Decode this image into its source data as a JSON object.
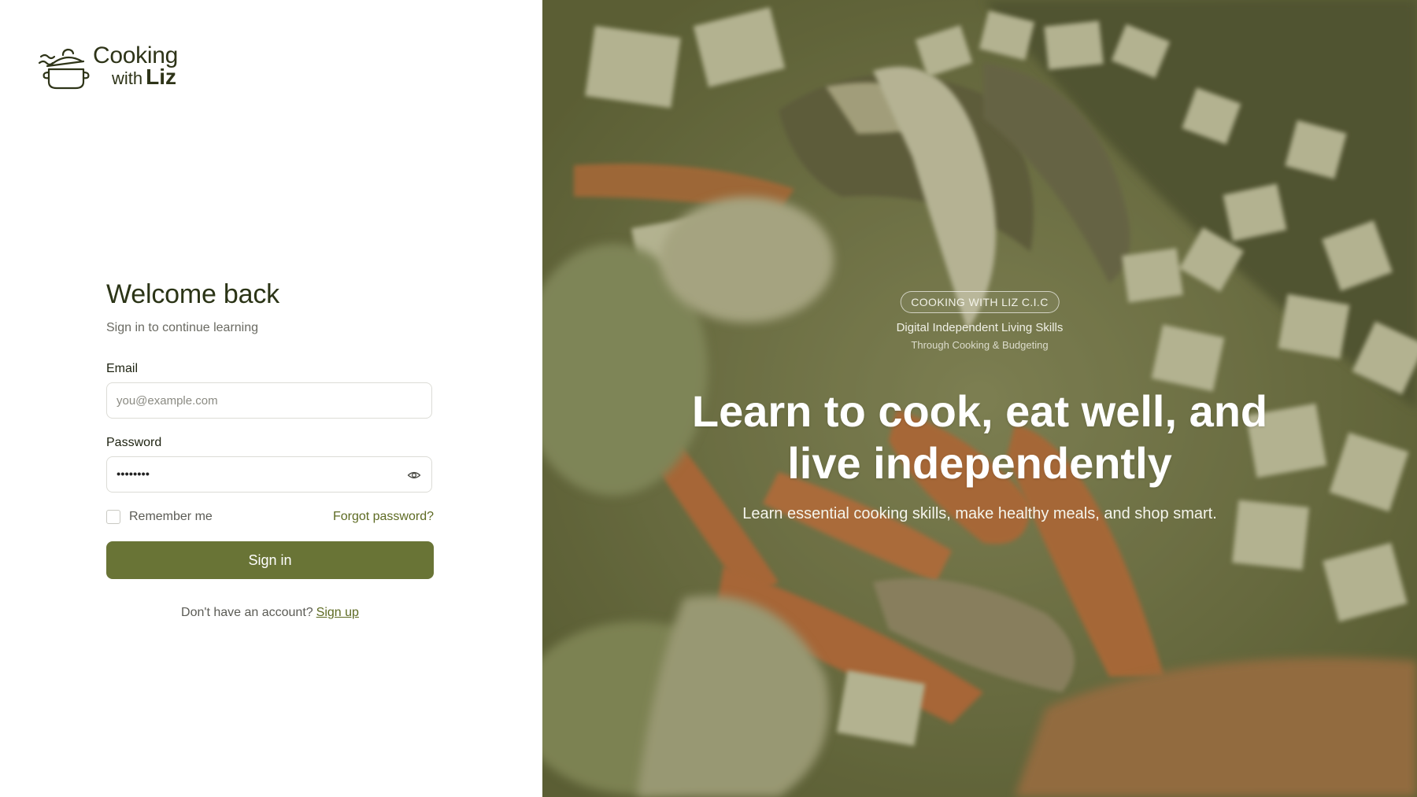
{
  "brand": {
    "line1": "Cooking",
    "line2_prefix": "with",
    "line2_name": "Liz"
  },
  "login": {
    "title": "Welcome back",
    "subtitle": "Sign in to continue learning",
    "email_label": "Email",
    "email_placeholder": "you@example.com",
    "email_value": "",
    "password_label": "Password",
    "password_masked": "••••••••",
    "remember_label": "Remember me",
    "remember_checked": false,
    "forgot_label": "Forgot password?",
    "signin_label": "Sign in",
    "signup_prompt": "Don't have an account?",
    "signup_label": "Sign up"
  },
  "hero": {
    "badge": "COOKING WITH LIZ C.I.C",
    "tagline": "Digital Independent Living Skills",
    "tagline2": "Through Cooking & Budgeting",
    "headline_line1": "Learn to cook, eat well, and",
    "headline_line2": "live independently",
    "subheadline": "Learn essential cooking skills, make healthy meals, and shop smart."
  },
  "colors": {
    "primary": "#697436",
    "link": "#5d6a22",
    "heading": "#2b3416",
    "hero_tint": "#586028"
  },
  "icons": {
    "logo": "cooking-pot-icon",
    "password_toggle": "eye-icon"
  }
}
